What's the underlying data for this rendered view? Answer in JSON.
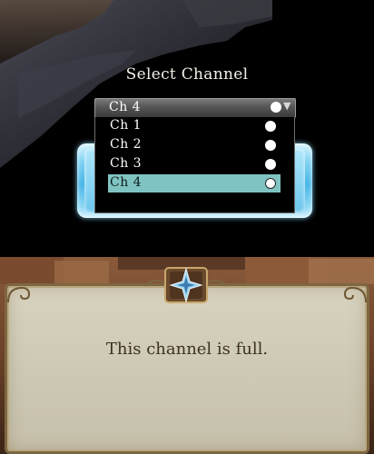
{
  "top_screen": {
    "title": "Select Channel",
    "channel_select": {
      "selected_label": "Ch 4",
      "options": [
        {
          "label": "Ch 1",
          "selected": false
        },
        {
          "label": "Ch 2",
          "selected": false
        },
        {
          "label": "Ch 3",
          "selected": false
        },
        {
          "label": "Ch 4",
          "selected": true
        }
      ]
    }
  },
  "bottom_screen": {
    "message": "This channel is full."
  },
  "colors": {
    "selected_highlight": "#7fc4c2",
    "panel_parchment": "#d2cdb9",
    "panel_border": "#7d6742",
    "message_text": "#3d3122",
    "ice_frame": "#6cc6ee"
  },
  "icons": {
    "emblem": "compass-star-icon",
    "dropdown_arrow": "chevron-down-icon"
  }
}
